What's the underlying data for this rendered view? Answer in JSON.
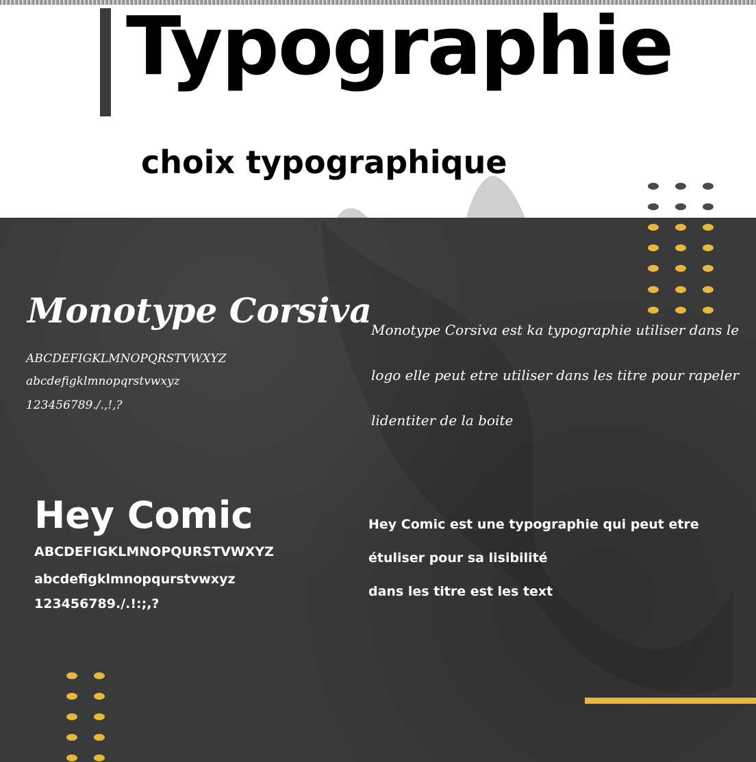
{
  "header": {
    "title": "Typographie",
    "subtitle": "choix typographique"
  },
  "colors": {
    "background_dark": "#3a3a3c",
    "accent_yellow": "#e8b83a",
    "dot_grey": "#4a4a4a",
    "text_light": "#ffffff",
    "text_dark": "#000000"
  },
  "fonts": [
    {
      "name": "Monotype Corsiva",
      "samples": [
        "ABCDEFIGKLMNOPQRSTVWXYZ",
        "abcdefigklmnopqrstvwxyz",
        "123456789./.,!,?"
      ],
      "description_lines": [
        "Monotype Corsiva est ka typographie utiliser dans le",
        "logo elle peut etre utiliser dans les titre pour rapeler",
        "lidentiter de la boite"
      ]
    },
    {
      "name": "Hey Comic",
      "samples": [
        "ABCDEFIGKLMNOPQURSTVWXYZ",
        "abcdefigklmnopqurstvwxyz",
        "123456789./.!:;,?"
      ],
      "description_lines": [
        "Hey Comic est une typographie qui peut etre",
        "étuliser pour sa lisibilité",
        "dans les titre est les text"
      ]
    }
  ]
}
